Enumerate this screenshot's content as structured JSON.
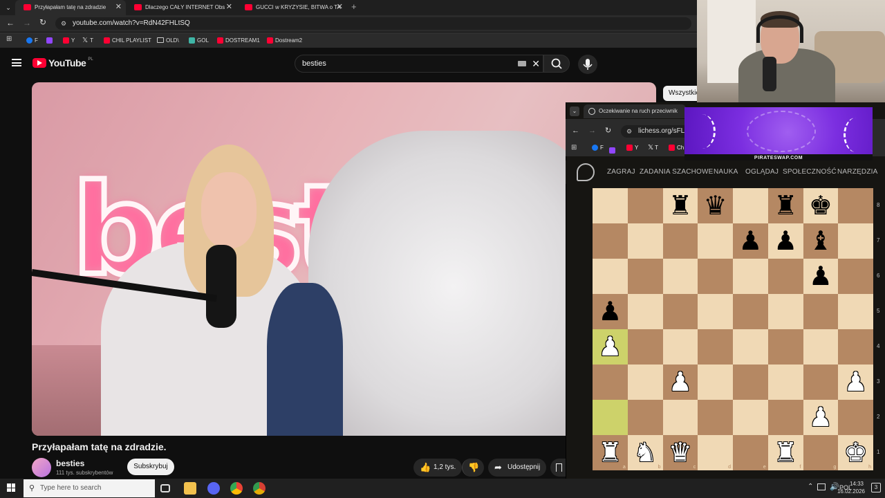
{
  "browser": {
    "tabs": [
      {
        "label": "Przyłapałam tatę na zdradzie",
        "active": true
      },
      {
        "label": "Dlaczego CAŁY INTERNET Obs",
        "active": false
      },
      {
        "label": "GUCCI w KRYZYSIE, BITWA o TA",
        "active": false
      }
    ],
    "url": "youtube.com/watch?v=RdN42FHLtSQ",
    "bookmarks": [
      "F",
      "",
      "Y",
      "T",
      "CHIL PLAYLIST",
      "OLD\\",
      "GOL",
      "DOSTREAM1",
      "Dostream2"
    ]
  },
  "youtube": {
    "logo": "YouTube",
    "region": "PL",
    "search_value": "besties",
    "filter_chip": "Wszystkie",
    "video_title": "Przyłapałam tatę na zdradzie.",
    "neon_sign": "besties",
    "channel": {
      "name": "besties",
      "subscribers": "111 tys. subskrybentów"
    },
    "subscribe_label": "Subskrybuj",
    "likes": "1,2 tys.",
    "share_label": "Udostępnij"
  },
  "lichess_window": {
    "tab_title": "Oczekiwanie na ruch przeciwnik",
    "url": "lichess.org/sFL9",
    "bookmarks": [
      "F",
      "",
      "Y",
      "T",
      "Ch"
    ],
    "ad_label": "PIRATESWAP.COM",
    "nav": [
      "ZAGRAJ",
      "ZADANIA SZACHOWE",
      "NAUKA",
      "OGLĄDAJ",
      "SPOŁECZNOŚĆ",
      "NARZĘDZIA"
    ],
    "files": [
      "a",
      "b",
      "c",
      "d",
      "e",
      "f",
      "g",
      "h"
    ],
    "ranks": [
      "8",
      "7",
      "6",
      "5",
      "4",
      "3",
      "2",
      "1"
    ],
    "board": [
      [
        "",
        "",
        "r",
        "q",
        "",
        "r",
        "k",
        ""
      ],
      [
        "",
        "",
        "",
        "",
        "p",
        "p",
        "b",
        ""
      ],
      [
        "",
        "",
        "",
        "",
        "",
        "",
        "p",
        ""
      ],
      [
        "p",
        "",
        "",
        "",
        "",
        "",
        "",
        ""
      ],
      [
        "P",
        "",
        "",
        "",
        "",
        "",
        "",
        ""
      ],
      [
        "",
        "",
        "P",
        "",
        "",
        "",
        "",
        "P"
      ],
      [
        "",
        "",
        "",
        "",
        "",
        "",
        "P",
        ""
      ],
      [
        "R",
        "N",
        "Q",
        "",
        "",
        "R",
        "",
        "K"
      ]
    ],
    "highlight_squares": [
      "a4",
      "a2"
    ]
  },
  "taskbar": {
    "search_placeholder": "Type here to search",
    "language": "POL",
    "time": "14:33",
    "date": "16.02.2026",
    "notifications": "3"
  },
  "colors": {
    "youtube_red": "#ff0033",
    "board_light": "#f0d9b5",
    "board_dark": "#b58863",
    "highlight": "#cdd26a"
  }
}
